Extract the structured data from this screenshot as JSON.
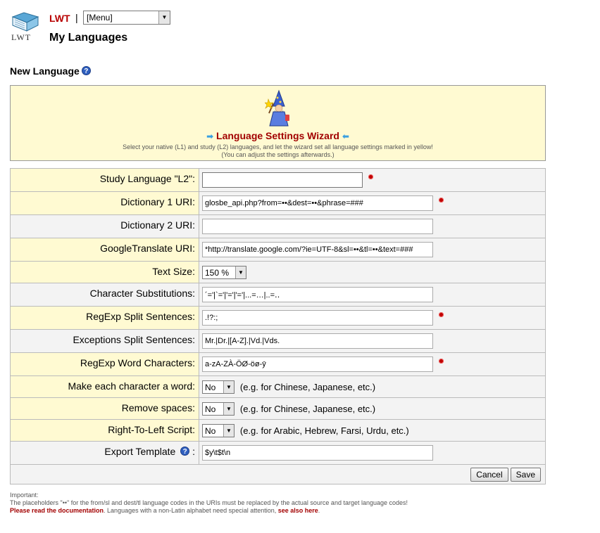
{
  "header": {
    "logo_text": "LWT",
    "app_link": "LWT",
    "separator": "|",
    "menu_value": "[Menu]",
    "page_title": "My Languages"
  },
  "section": {
    "title": "New Language",
    "help": "?"
  },
  "wizard": {
    "title": "Language Settings Wizard",
    "desc1": "Select your native (L1) and study (L2) languages, and let the wizard set all language settings marked in yellow!",
    "desc2": "(You can adjust the settings afterwards.)"
  },
  "form": {
    "study_language": {
      "label": "Study Language \"L2\":",
      "value": ""
    },
    "dict1": {
      "label": "Dictionary 1 URI:",
      "value": "glosbe_api.php?from=••&dest=••&phrase=###"
    },
    "dict2": {
      "label": "Dictionary 2 URI:",
      "value": ""
    },
    "gtranslate": {
      "label": "GoogleTranslate URI:",
      "value": "*http://translate.google.com/?ie=UTF-8&sl=••&tl=••&text=###"
    },
    "textsize": {
      "label": "Text Size:",
      "value": "150 %"
    },
    "charsubst": {
      "label": "Character Substitutions:",
      "value": "´='|`='|'='|'='|...=…|..=‥"
    },
    "regexp_split": {
      "label": "RegExp Split Sentences:",
      "value": ".!?:;"
    },
    "exceptions_split": {
      "label": "Exceptions Split Sentences:",
      "value": "Mr.|Dr.|[A-Z].|Vd.|Vds."
    },
    "regexp_word": {
      "label": "RegExp Word Characters:",
      "value": "a-zA-ZÀ-ÖØ-öø-ȳ"
    },
    "split_each_char": {
      "label": "Make each character a word:",
      "value": "No",
      "hint": "(e.g. for Chinese, Japanese, etc.)"
    },
    "remove_spaces": {
      "label": "Remove spaces:",
      "value": "No",
      "hint": "(e.g. for Chinese, Japanese, etc.)"
    },
    "rtl": {
      "label": "Right-To-Left Script:",
      "value": "No",
      "hint": "(e.g. for Arabic, Hebrew, Farsi, Urdu, etc.)"
    },
    "export_template": {
      "label": "Export Template",
      "label_suffix": " :",
      "value": "$y\\t$t\\n"
    }
  },
  "buttons": {
    "cancel": "Cancel",
    "save": "Save"
  },
  "footnote": {
    "line1": "Important:",
    "line2": "The placeholders \"••\" for the from/sl and dest/tl language codes in the URIs must be replaced by the actual source and target language codes!",
    "read_docs": "Please read the documentation",
    "mid": ". Languages with a non-Latin alphabet need special attention, ",
    "see_also": "see also here",
    "end": "."
  },
  "colors": {
    "accent_red": "#a20000",
    "highlight_yellow": "#fffad2",
    "required_dot": "#c00000"
  }
}
